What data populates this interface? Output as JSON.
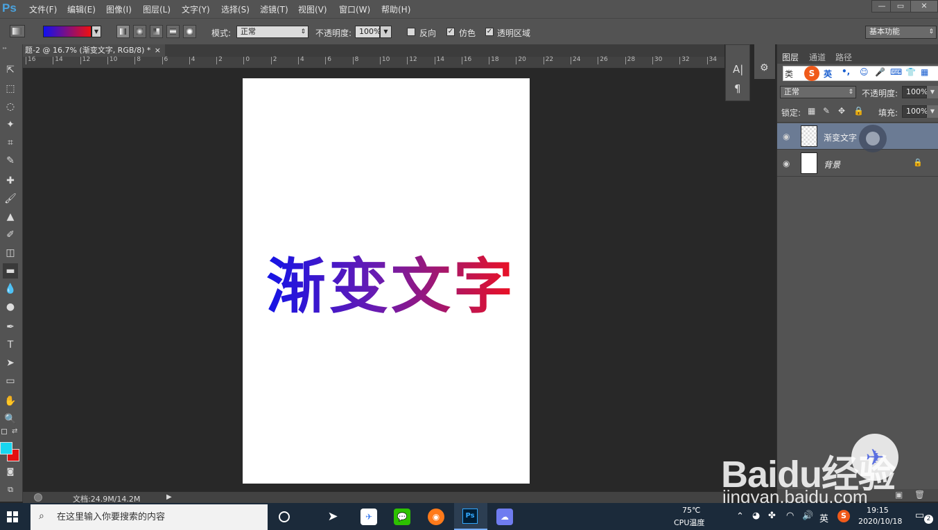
{
  "menubar": {
    "logo": "Ps",
    "items": [
      "文件(F)",
      "编辑(E)",
      "图像(I)",
      "图层(L)",
      "文字(Y)",
      "选择(S)",
      "滤镜(T)",
      "视图(V)",
      "窗口(W)",
      "帮助(H)"
    ],
    "window_buttons": [
      "—",
      "▭",
      "✕"
    ]
  },
  "options": {
    "mode_label": "模式:",
    "mode_value": "正常",
    "opacity_label": "不透明度:",
    "opacity_value": "100%",
    "reverse_label": "反向",
    "dither_label": "仿色",
    "transparency_label": "透明区域",
    "workspace_value": "基本功能",
    "gradient_colors": [
      "#1010f0",
      "#f01010"
    ]
  },
  "document_tab": {
    "title": "题-2 @ 16.7% (渐变文字, RGB/8) *",
    "close": "×"
  },
  "ruler": {
    "ticks": [
      "16",
      "14",
      "12",
      "10",
      "8",
      "6",
      "4",
      "2",
      "0",
      "2",
      "4",
      "6",
      "8",
      "10",
      "12",
      "14",
      "16",
      "18",
      "20",
      "22",
      "24",
      "26",
      "28",
      "30",
      "32",
      "34"
    ]
  },
  "canvas": {
    "text": "渐变文字",
    "gradient_start": "#1414e6",
    "gradient_end": "#ee1020"
  },
  "status": {
    "doc_size": "文档:24.9M/14.2M"
  },
  "tools": [
    "⇱",
    "⬚",
    "◌",
    "✦",
    "⌗",
    "✎",
    "✚",
    "🖌",
    "▲",
    "✐",
    "◫",
    "▬",
    "💧",
    "●",
    "✒",
    "T",
    "➤",
    "▭",
    "✋",
    "🔍"
  ],
  "colors": {
    "foreground": "#18d6f0",
    "background": "#e41010"
  },
  "layers_panel": {
    "tabs": [
      "图层",
      "通道",
      "路径"
    ],
    "filter_label": "类",
    "blend_mode": "正常",
    "opacity_label": "不透明度:",
    "opacity_value": "100%",
    "lock_label": "锁定:",
    "fill_label": "填充:",
    "fill_value": "100%",
    "layers": [
      {
        "name": "渐变文字",
        "selected": true
      },
      {
        "name": "背景",
        "selected": false,
        "locked": true
      }
    ]
  },
  "ime_bar": {
    "logo": "S",
    "lang": "英",
    "punct": "•,"
  },
  "taskbar": {
    "search_placeholder": "在这里输入你要搜索的内容",
    "temp": "75℃",
    "temp_label": "CPU温度",
    "lang": "英",
    "time": "19:15",
    "date": "2020/10/18",
    "notifications": "2"
  },
  "watermark": {
    "brand": "Baidu经验",
    "url": "jingyan.baidu.com"
  }
}
